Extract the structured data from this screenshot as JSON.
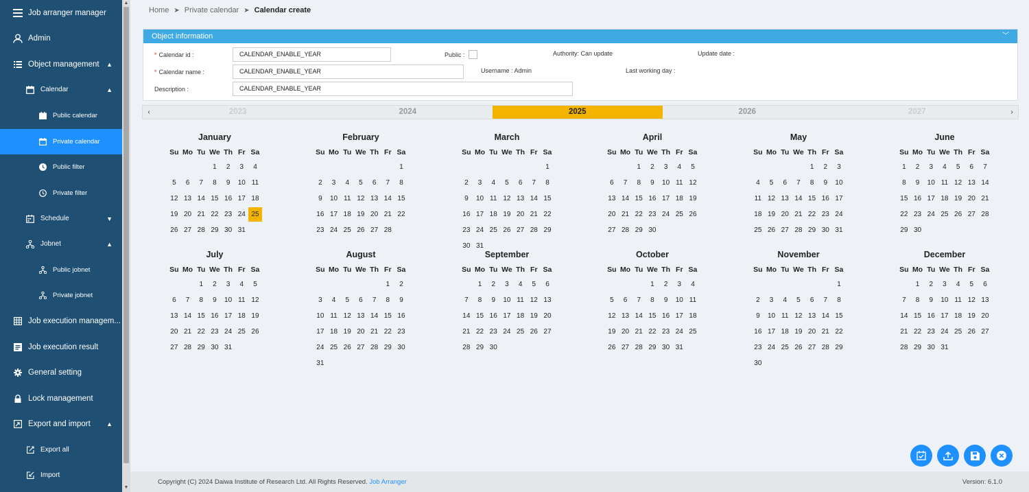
{
  "app": {
    "title": "Job arranger manager"
  },
  "sidebar": {
    "user": "Admin",
    "object_management": "Object management",
    "calendar": "Calendar",
    "public_calendar": "Public calendar",
    "private_calendar": "Private calendar",
    "public_filter": "Public filter",
    "private_filter": "Private filter",
    "schedule": "Schedule",
    "jobnet": "Jobnet",
    "public_jobnet": "Public jobnet",
    "private_jobnet": "Private jobnet",
    "job_execution_management": "Job execution managem...",
    "job_execution_result": "Job execution result",
    "general_setting": "General setting",
    "lock_management": "Lock management",
    "export_and_import": "Export and import",
    "export_all": "Export all",
    "import": "Import"
  },
  "breadcrumb": {
    "home": "Home",
    "private_calendar": "Private calendar",
    "current": "Calendar create"
  },
  "object_info": {
    "title": "Object information",
    "calendar_id_label": "Calendar id :",
    "calendar_id_value": "CALENDAR_ENABLE_YEAR",
    "calendar_name_label": "Calendar name :",
    "calendar_name_value": "CALENDAR_ENABLE_YEAR",
    "description_label": "Description :",
    "description_value": "CALENDAR_ENABLE_YEAR",
    "public_label": "Public :",
    "public_checked": false,
    "authority": "Authority: Can update",
    "username": "Username : Admin",
    "update_date_label": "Update date :",
    "last_working_day_label": "Last working day :"
  },
  "years": [
    {
      "label": "2023",
      "state": "far"
    },
    {
      "label": "2024",
      "state": "near"
    },
    {
      "label": "2025",
      "state": "selected"
    },
    {
      "label": "2026",
      "state": "near"
    },
    {
      "label": "2027",
      "state": "far"
    }
  ],
  "weekdays": [
    "Su",
    "Mo",
    "Tu",
    "We",
    "Th",
    "Fr",
    "Sa"
  ],
  "months": [
    {
      "name": "January",
      "weeks": [
        [
          "",
          "",
          "",
          1,
          2,
          3,
          4
        ],
        [
          5,
          6,
          7,
          8,
          9,
          10,
          11
        ],
        [
          12,
          13,
          14,
          15,
          16,
          17,
          18
        ],
        [
          19,
          20,
          21,
          22,
          23,
          24,
          25
        ],
        [
          26,
          27,
          28,
          29,
          30,
          31,
          ""
        ]
      ]
    },
    {
      "name": "February",
      "weeks": [
        [
          "",
          "",
          "",
          "",
          "",
          "",
          1
        ],
        [
          2,
          3,
          4,
          5,
          6,
          7,
          8
        ],
        [
          9,
          10,
          11,
          12,
          13,
          14,
          15
        ],
        [
          16,
          17,
          18,
          19,
          20,
          21,
          22
        ],
        [
          23,
          24,
          25,
          26,
          27,
          28,
          ""
        ]
      ]
    },
    {
      "name": "March",
      "weeks": [
        [
          "",
          "",
          "",
          "",
          "",
          "",
          1
        ],
        [
          2,
          3,
          4,
          5,
          6,
          7,
          8
        ],
        [
          9,
          10,
          11,
          12,
          13,
          14,
          15
        ],
        [
          16,
          17,
          18,
          19,
          20,
          21,
          22
        ],
        [
          23,
          24,
          25,
          26,
          27,
          28,
          29
        ],
        [
          30,
          31,
          "",
          "",
          "",
          "",
          ""
        ]
      ]
    },
    {
      "name": "April",
      "weeks": [
        [
          "",
          "",
          1,
          2,
          3,
          4,
          5
        ],
        [
          6,
          7,
          8,
          9,
          10,
          11,
          12
        ],
        [
          13,
          14,
          15,
          16,
          17,
          18,
          19
        ],
        [
          20,
          21,
          22,
          23,
          24,
          25,
          26
        ],
        [
          27,
          28,
          29,
          30,
          "",
          "",
          ""
        ]
      ]
    },
    {
      "name": "May",
      "weeks": [
        [
          "",
          "",
          "",
          "",
          1,
          2,
          3
        ],
        [
          4,
          5,
          6,
          7,
          8,
          9,
          10
        ],
        [
          11,
          12,
          13,
          14,
          15,
          16,
          17
        ],
        [
          18,
          19,
          20,
          21,
          22,
          23,
          24
        ],
        [
          25,
          26,
          27,
          28,
          29,
          30,
          31
        ]
      ]
    },
    {
      "name": "June",
      "weeks": [
        [
          1,
          2,
          3,
          4,
          5,
          6,
          7
        ],
        [
          8,
          9,
          10,
          11,
          12,
          13,
          14
        ],
        [
          15,
          16,
          17,
          18,
          19,
          20,
          21
        ],
        [
          22,
          23,
          24,
          25,
          26,
          27,
          28
        ],
        [
          29,
          30,
          "",
          "",
          "",
          "",
          ""
        ]
      ]
    },
    {
      "name": "July",
      "weeks": [
        [
          "",
          "",
          1,
          2,
          3,
          4,
          5
        ],
        [
          6,
          7,
          8,
          9,
          10,
          11,
          12
        ],
        [
          13,
          14,
          15,
          16,
          17,
          18,
          19
        ],
        [
          20,
          21,
          22,
          23,
          24,
          25,
          26
        ],
        [
          27,
          28,
          29,
          30,
          31,
          "",
          ""
        ]
      ]
    },
    {
      "name": "August",
      "weeks": [
        [
          "",
          "",
          "",
          "",
          "",
          1,
          2
        ],
        [
          3,
          4,
          5,
          6,
          7,
          8,
          9
        ],
        [
          10,
          11,
          12,
          13,
          14,
          15,
          16
        ],
        [
          17,
          18,
          19,
          20,
          21,
          22,
          23
        ],
        [
          24,
          25,
          26,
          27,
          28,
          29,
          30
        ],
        [
          31,
          "",
          "",
          "",
          "",
          "",
          ""
        ]
      ]
    },
    {
      "name": "September",
      "weeks": [
        [
          "",
          1,
          2,
          3,
          4,
          5,
          6
        ],
        [
          7,
          8,
          9,
          10,
          11,
          12,
          13
        ],
        [
          14,
          15,
          16,
          17,
          18,
          19,
          20
        ],
        [
          21,
          22,
          23,
          24,
          25,
          26,
          27
        ],
        [
          28,
          29,
          30,
          "",
          "",
          "",
          ""
        ]
      ]
    },
    {
      "name": "October",
      "weeks": [
        [
          "",
          "",
          "",
          1,
          2,
          3,
          4
        ],
        [
          5,
          6,
          7,
          8,
          9,
          10,
          11
        ],
        [
          12,
          13,
          14,
          15,
          16,
          17,
          18
        ],
        [
          19,
          20,
          21,
          22,
          23,
          24,
          25
        ],
        [
          26,
          27,
          28,
          29,
          30,
          31,
          ""
        ]
      ]
    },
    {
      "name": "November",
      "weeks": [
        [
          "",
          "",
          "",
          "",
          "",
          "",
          1
        ],
        [
          2,
          3,
          4,
          5,
          6,
          7,
          8
        ],
        [
          9,
          10,
          11,
          12,
          13,
          14,
          15
        ],
        [
          16,
          17,
          18,
          19,
          20,
          21,
          22
        ],
        [
          23,
          24,
          25,
          26,
          27,
          28,
          29
        ],
        [
          30,
          "",
          "",
          "",
          "",
          "",
          ""
        ]
      ]
    },
    {
      "name": "December",
      "weeks": [
        [
          "",
          1,
          2,
          3,
          4,
          5,
          6
        ],
        [
          7,
          8,
          9,
          10,
          11,
          12,
          13
        ],
        [
          14,
          15,
          16,
          17,
          18,
          19,
          20
        ],
        [
          21,
          22,
          23,
          24,
          25,
          26,
          27
        ],
        [
          28,
          29,
          30,
          31,
          "",
          "",
          ""
        ]
      ]
    }
  ],
  "highlighted_day": {
    "month": "January",
    "day": 25
  },
  "footer": {
    "copyright": "Copyright (C) 2024 Daiwa Institute of Research Ltd. All Rights Reserved.",
    "link": "Job Arranger",
    "version": "Version: 6.1.0"
  },
  "colors": {
    "sidebar": "#1f4f73",
    "active": "#1e90ff",
    "header": "#3ea9e3",
    "selected_year": "#f3b400",
    "required": "#e02b2b"
  }
}
